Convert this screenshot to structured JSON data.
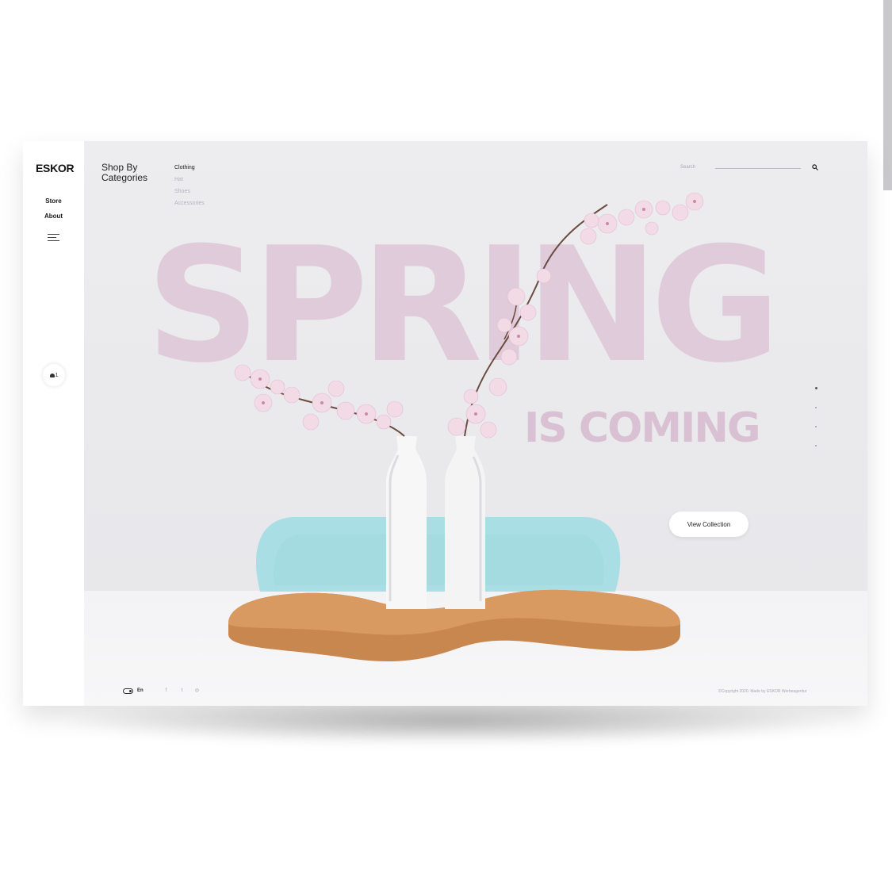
{
  "sidebar": {
    "logo": "ESKOR",
    "nav": [
      {
        "label": "Store"
      },
      {
        "label": "About"
      }
    ],
    "cart_count": "1"
  },
  "categories": {
    "title_line1": "Shop By",
    "title_line2": "Categories",
    "items": [
      "Clothing",
      "Hat",
      "Shoes",
      "Accessories"
    ]
  },
  "search": {
    "placeholder": "Search"
  },
  "hero": {
    "headline": "SPRING",
    "subheadline": "IS COMING",
    "cta_label": "View Collection",
    "slide_count": 4,
    "active_slide": 1
  },
  "footer": {
    "language": "En",
    "social_icons": [
      "facebook-icon",
      "twitter-icon",
      "instagram-icon"
    ],
    "copyright": "©Copyright 2020. Made by ESKOR Werbeagentur"
  },
  "colors": {
    "headline": "#dfcbd9",
    "background": "#ededef",
    "chair": "#a9dfe4",
    "board": "#c8874f"
  }
}
